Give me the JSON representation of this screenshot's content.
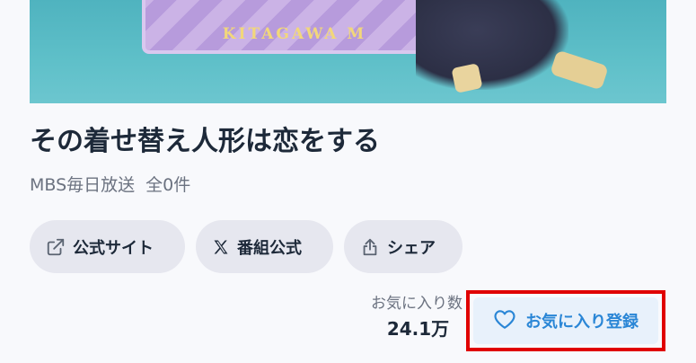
{
  "hero": {
    "box_text": "KITAGAWA M"
  },
  "program": {
    "title": "その着せ替え人形は恋をする",
    "broadcaster": "MBS毎日放送",
    "episode_count": "全0件"
  },
  "actions": {
    "official_site": "公式サイト",
    "x_account": "番組公式",
    "share": "シェア"
  },
  "favorites": {
    "count_label": "お気に入り数",
    "count_value": "24.1万",
    "register_label": "お気に入り登録"
  },
  "colors": {
    "accent": "#2a86d6",
    "highlight_border": "#e00000",
    "text_primary": "#1d2939",
    "text_muted": "#6b7280"
  },
  "icons": {
    "official_site": "external-link-icon",
    "x_account": "x-logo-icon",
    "share": "share-icon",
    "favorite": "heart-icon"
  }
}
